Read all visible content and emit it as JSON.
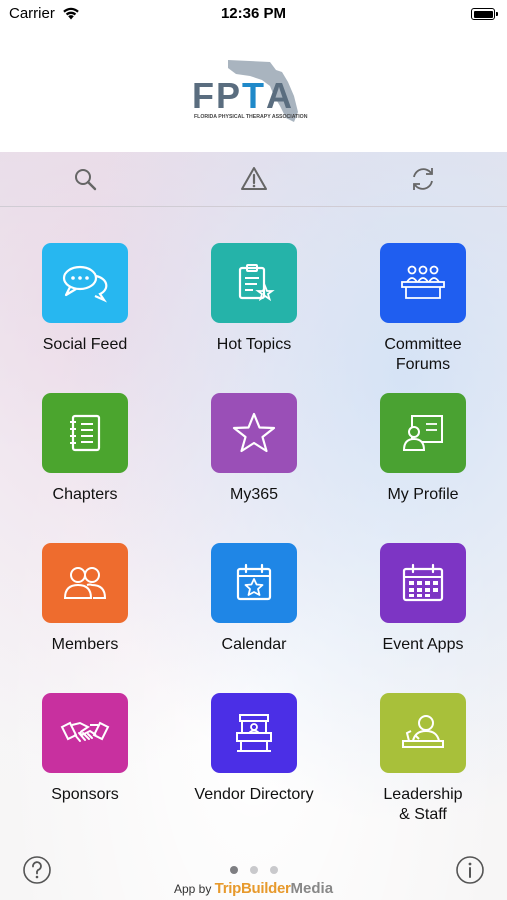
{
  "status_bar": {
    "carrier": "Carrier",
    "time": "12:36 PM"
  },
  "logo": {
    "text": "FPTA",
    "subtitle": "FLORIDA PHYSICAL THERAPY ASSOCIATION"
  },
  "toolbar": {
    "icons": [
      "search-icon",
      "alert-icon",
      "refresh-icon"
    ]
  },
  "tiles": [
    {
      "label": "Social Feed",
      "color": "#27b7f0",
      "icon": "chat-bubbles-icon"
    },
    {
      "label": "Hot Topics",
      "color": "#25b3a9",
      "icon": "clipboard-star-icon"
    },
    {
      "label": "Committee\nForums",
      "color": "#1f5ef0",
      "icon": "panel-people-icon"
    },
    {
      "label": "Chapters",
      "color": "#4ba52e",
      "icon": "notebook-icon"
    },
    {
      "label": "My365",
      "color": "#9a4fb7",
      "icon": "star-icon"
    },
    {
      "label": "My Profile",
      "color": "#4aa232",
      "icon": "profile-card-icon"
    },
    {
      "label": "Members",
      "color": "#ee6c2e",
      "icon": "people-icon"
    },
    {
      "label": "Calendar",
      "color": "#1f86e6",
      "icon": "calendar-star-icon"
    },
    {
      "label": "Event Apps",
      "color": "#7d35c4",
      "icon": "calendar-grid-icon"
    },
    {
      "label": "Sponsors",
      "color": "#c8309f",
      "icon": "handshake-icon"
    },
    {
      "label": "Vendor Directory",
      "color": "#4b2fe6",
      "icon": "booth-icon"
    },
    {
      "label": "Leadership\n& Staff",
      "color": "#a8c03a",
      "icon": "speaker-icon"
    }
  ],
  "footer": {
    "credit_prefix": "App by",
    "credit_brand": "TripBuilder",
    "credit_brand2": "Media",
    "page_dots": 3,
    "active_page": 1
  }
}
